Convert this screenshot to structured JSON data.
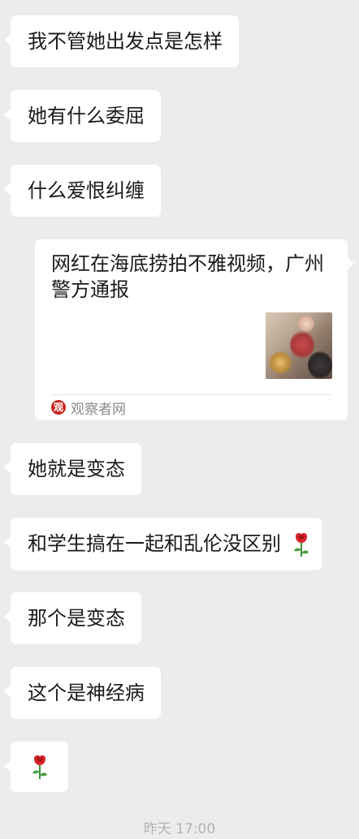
{
  "messages": [
    {
      "text": "我不管她出发点是怎样"
    },
    {
      "text": "她有什么委屈"
    },
    {
      "text": "什么爱恨纠缠"
    },
    {
      "text": "她就是变态"
    },
    {
      "text": "和学生搞在一起和乱伦没区别"
    },
    {
      "text": "那个是变态"
    },
    {
      "text": "这个是神经病"
    }
  ],
  "link_card": {
    "title": "网红在海底捞拍不雅视频，广州警方通报",
    "source_name": "观察者网",
    "source_logo_text": "观",
    "thumbnail_desc": "blurred-image"
  },
  "icons": {
    "rose": "rose-emoji"
  },
  "colors": {
    "background": "#ececec",
    "bubble": "#ffffff",
    "text": "#1a1a1a",
    "source_logo": "#c8281e"
  },
  "timestamp": "昨天 17:00"
}
